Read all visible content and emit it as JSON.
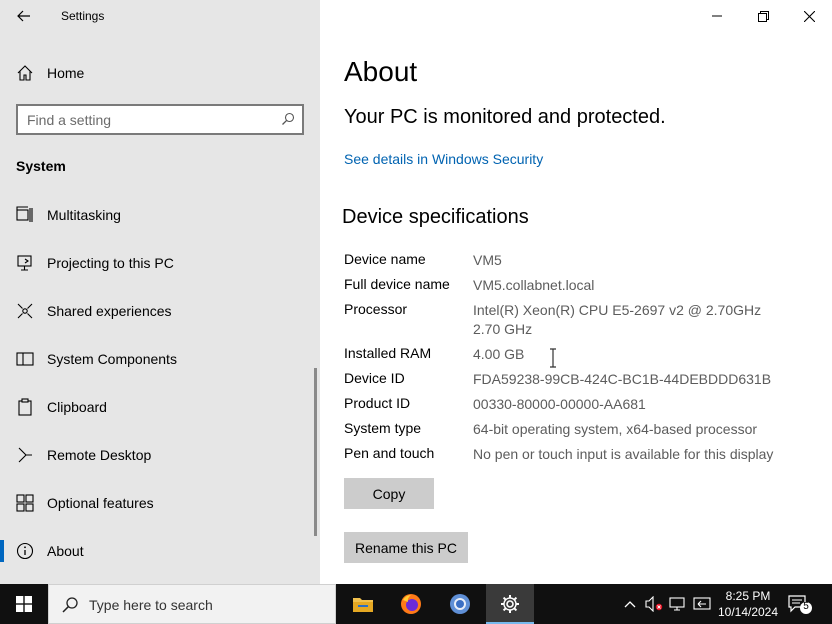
{
  "window": {
    "title": "Settings"
  },
  "sidebar": {
    "home_label": "Home",
    "search_placeholder": "Find a setting",
    "section": "System",
    "items": [
      {
        "label": "Multitasking",
        "icon": "multitasking-icon"
      },
      {
        "label": "Projecting to this PC",
        "icon": "projecting-icon"
      },
      {
        "label": "Shared experiences",
        "icon": "shared-experiences-icon"
      },
      {
        "label": "System Components",
        "icon": "system-components-icon"
      },
      {
        "label": "Clipboard",
        "icon": "clipboard-icon"
      },
      {
        "label": "Remote Desktop",
        "icon": "remote-desktop-icon"
      },
      {
        "label": "Optional features",
        "icon": "optional-features-icon"
      },
      {
        "label": "About",
        "icon": "info-icon",
        "active": true
      }
    ]
  },
  "main": {
    "title": "About",
    "protection": "Your PC is monitored and protected.",
    "security_link": "See details in Windows Security",
    "spec_heading": "Device specifications",
    "specs": [
      {
        "key": "Device name",
        "value": "VM5"
      },
      {
        "key": "Full device name",
        "value": "VM5.collabnet.local"
      },
      {
        "key": "Processor",
        "value": "Intel(R) Xeon(R) CPU E5-2697 v2 @ 2.70GHz   2.70 GHz"
      },
      {
        "key": "Installed RAM",
        "value": "4.00 GB"
      },
      {
        "key": "Device ID",
        "value": "FDA59238-99CB-424C-BC1B-44DEBDDD631B"
      },
      {
        "key": "Product ID",
        "value": "00330-80000-00000-AA681"
      },
      {
        "key": "System type",
        "value": "64-bit operating system, x64-based processor"
      },
      {
        "key": "Pen and touch",
        "value": "No pen or touch input is available for this display"
      }
    ],
    "copy_label": "Copy",
    "rename_label": "Rename this PC"
  },
  "taskbar": {
    "search_text": "Type here to search",
    "apps": [
      "file-explorer-icon",
      "firefox-icon",
      "chrome-icon",
      "settings-gear-icon"
    ],
    "time": "8:25 PM",
    "date": "10/14/2024",
    "notification_count": "5"
  },
  "colors": {
    "sidebar_bg": "#e6e6e6",
    "link": "#0063b1",
    "accent": "#0067c0",
    "taskbar": "#101010"
  }
}
